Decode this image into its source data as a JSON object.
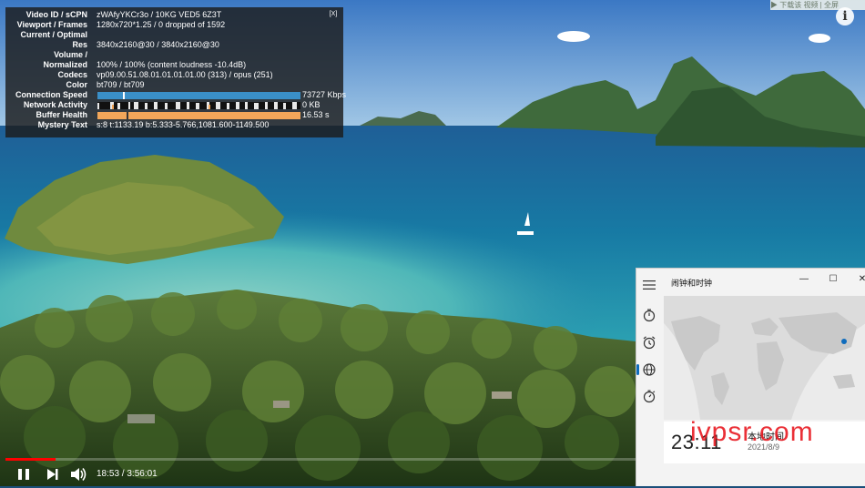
{
  "stats": {
    "rows": [
      {
        "key": "Video ID / sCPN",
        "value": "zWAfyYKCr3o / 10KG VED5 6Z3T"
      },
      {
        "key": "Viewport / Frames",
        "value": "1280x720*1.25 / 0 dropped of 1592"
      },
      {
        "key": "Current / Optimal",
        "value": ""
      },
      {
        "key": "Res",
        "value": "3840x2160@30 / 3840x2160@30"
      },
      {
        "key": "Volume /",
        "value": ""
      },
      {
        "key": "Normalized",
        "value": "100% / 100% (content loudness -10.4dB)"
      },
      {
        "key": "Codecs",
        "value": "vp09.00.51.08.01.01.01.01.00 (313) / opus (251)"
      },
      {
        "key": "Color",
        "value": "bt709 / bt709"
      }
    ],
    "connection_speed": {
      "key": "Connection Speed",
      "value": "73727 Kbps"
    },
    "network_activity": {
      "key": "Network Activity",
      "value": "0 KB"
    },
    "buffer_health": {
      "key": "Buffer Health",
      "value": "16.53 s"
    },
    "mystery_text": {
      "key": "Mystery Text",
      "value": "s:8 t:1133.19 b:5.333-5.766,1081.600-1149.500"
    },
    "close_label": "[X]",
    "colors": {
      "connection": "#3a8fc7",
      "network": "#e8e8e8",
      "buffer": "#f2a65a"
    }
  },
  "overlay": {
    "info_icon": "i",
    "download_tip": "▶ 下载该 视频 | 全屏"
  },
  "player": {
    "play_state_icon": "pause-icon",
    "time_current": "18:53",
    "time_total": "3:56:01",
    "time_separator": " / ",
    "progress_fraction": 0.08,
    "accent": "#ff0000"
  },
  "clock_app": {
    "title": "闹钟和时钟",
    "minimize": "—",
    "maximize": "☐",
    "close": "✕",
    "clock_time": "23:11",
    "clock_label": "本地时间",
    "clock_date": "2021/8/9",
    "accent": "#0f6cbd"
  },
  "watermark": "ivpsr.com"
}
